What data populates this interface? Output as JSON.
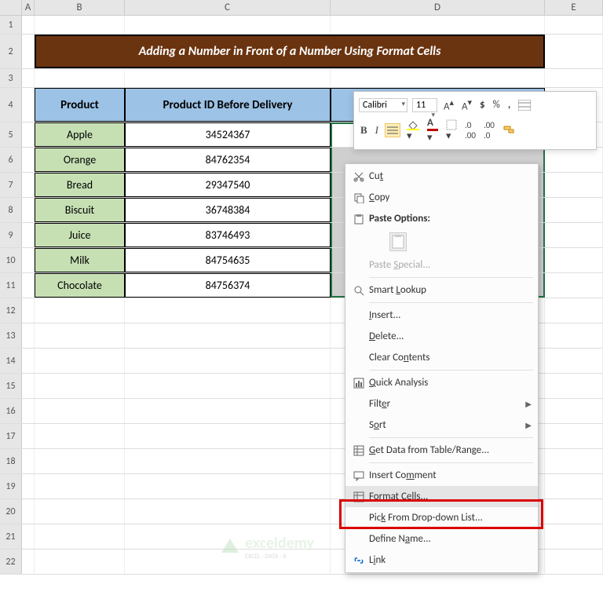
{
  "columns": [
    "",
    "A",
    "B",
    "C",
    "D",
    "E"
  ],
  "row_numbers": [
    1,
    2,
    3,
    4,
    5,
    6,
    7,
    8,
    9,
    10,
    11,
    12,
    13,
    14,
    15,
    16,
    17,
    18,
    19,
    20,
    21,
    22
  ],
  "title": "Adding a Number in Front of a Number Using Format Cells",
  "headers": {
    "product": "Product",
    "pid": "Product ID Before Delivery"
  },
  "rows": [
    {
      "product": "Apple",
      "pid": "34524367"
    },
    {
      "product": "Orange",
      "pid": "84762354"
    },
    {
      "product": "Bread",
      "pid": "29347540"
    },
    {
      "product": "Biscuit",
      "pid": "36748384"
    },
    {
      "product": "Juice",
      "pid": "83746493"
    },
    {
      "product": "Milk",
      "pid": "84754635"
    },
    {
      "product": "Chocolate",
      "pid": "84756374"
    }
  ],
  "sel_first": "34524367",
  "mini": {
    "font": "Calibri",
    "size": "11",
    "bold": "B",
    "italic": "I"
  },
  "menu": {
    "cut": "Cut",
    "copy": "Copy",
    "paste_opts": "Paste Options:",
    "paste_special": "Paste Special...",
    "smart": "Smart Lookup",
    "insert": "Insert...",
    "delete": "Delete...",
    "clear": "Clear Contents",
    "quick": "Quick Analysis",
    "filter": "Filter",
    "sort": "Sort",
    "getdata": "Get Data from Table/Range...",
    "comment": "Insert Comment",
    "format": "Format Cells...",
    "pick": "Pick From Drop-down List...",
    "define": "Define Name...",
    "link": "Link"
  },
  "watermark": {
    "main": "exceldemy",
    "sub": "EXCEL · DATA · B"
  }
}
